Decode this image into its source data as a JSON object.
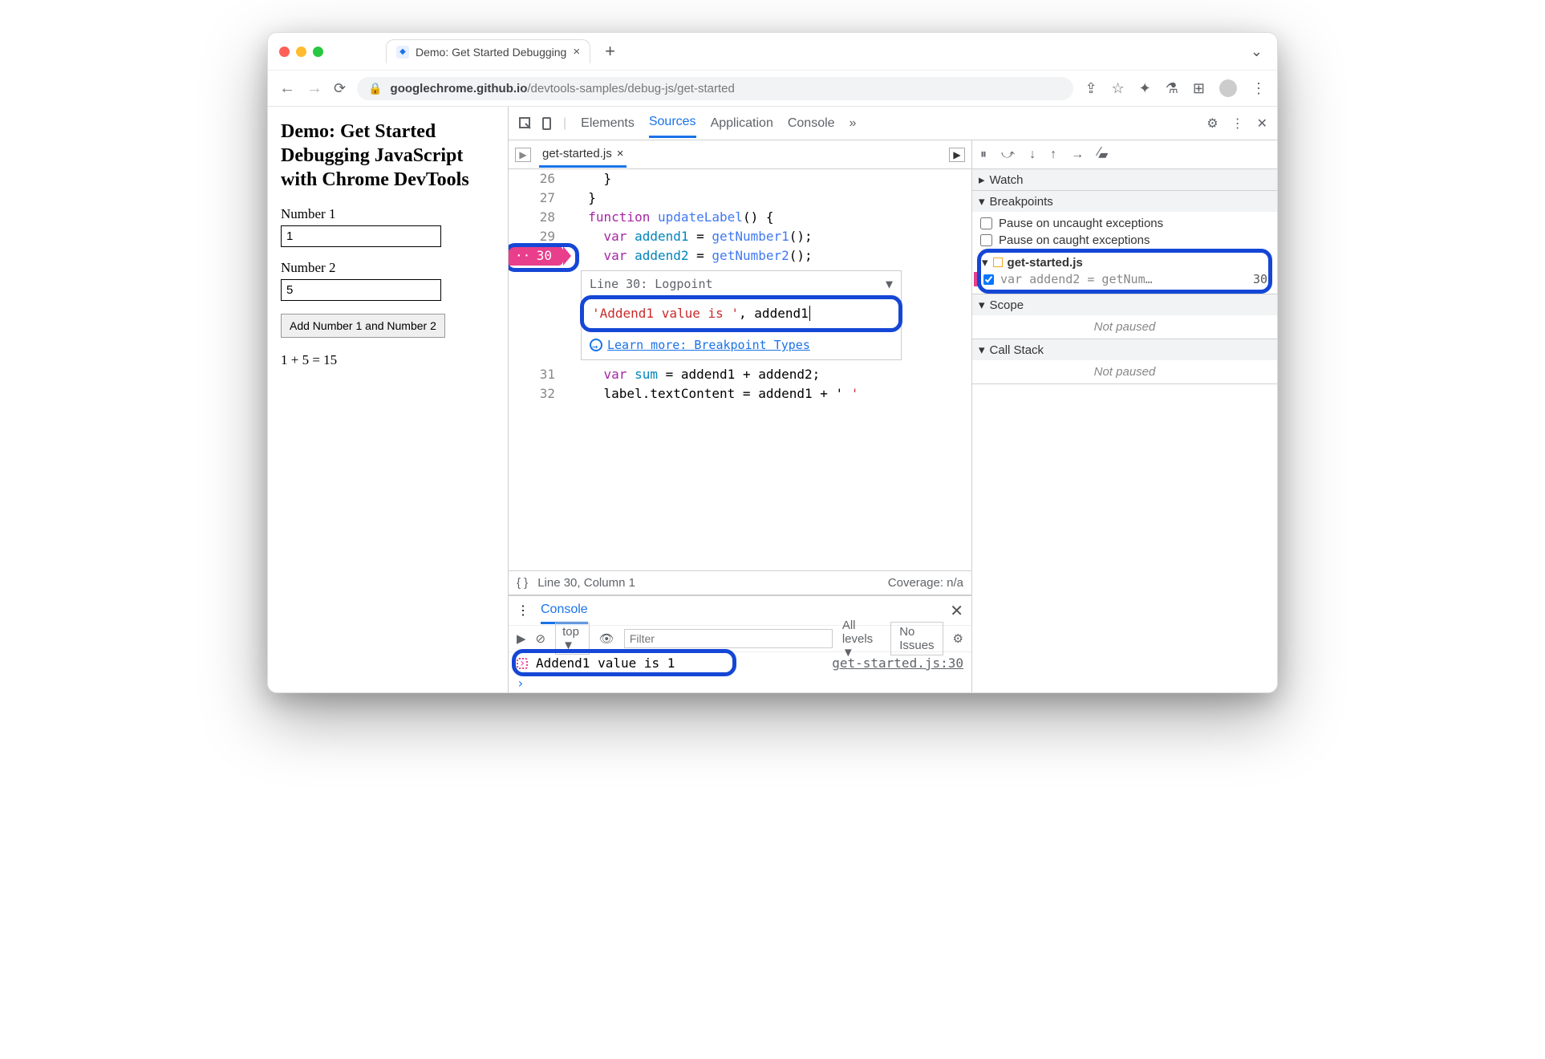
{
  "browser": {
    "tab_title": "Demo: Get Started Debugging",
    "url_host": "googlechrome.github.io",
    "url_path": "/devtools-samples/debug-js/get-started"
  },
  "page": {
    "heading": "Demo: Get Started Debugging JavaScript with Chrome DevTools",
    "label1": "Number 1",
    "value1": "1",
    "label2": "Number 2",
    "value2": "5",
    "button": "Add Number 1 and Number 2",
    "result": "1 + 5 = 15"
  },
  "devtools": {
    "tabs": [
      "Elements",
      "Sources",
      "Application",
      "Console"
    ],
    "active_tab": "Sources",
    "file": "get-started.js",
    "code": {
      "l26": "    }",
      "l27": "  }",
      "l28_a": "function",
      "l28_b": "updateLabel",
      "l28_c": "() {",
      "l29_a": "var",
      "l29_b": "addend1",
      "l29_c": " = ",
      "l29_d": "getNumber1",
      "l29_e": "();",
      "l30_a": "var",
      "l30_b": "addend2",
      "l30_c": " = ",
      "l30_d": "getNumber2",
      "l30_e": "();",
      "l31_a": "var",
      "l31_b": "sum",
      "l31_c": " = addend1 + addend2;",
      "l32": "    label.textContent = addend1 + ' "
    },
    "line_nums": {
      "n26": "26",
      "n27": "27",
      "n28": "28",
      "n29": "29",
      "n30": "30",
      "n31": "31",
      "n32": "32"
    },
    "logpoint": {
      "header": "Line 30:   Logpoint",
      "body": "'Addend1 value is ', addend1",
      "link": "Learn more: Breakpoint Types"
    },
    "status_left": "{ }",
    "status_pos": "Line 30, Column 1",
    "status_cov": "Coverage: n/a",
    "side": {
      "watch": "Watch",
      "breakpoints": "Breakpoints",
      "pause_uncaught": "Pause on uncaught exceptions",
      "pause_caught": "Pause on caught exceptions",
      "bp_file": "get-started.js",
      "bp_text": "var addend2 = getNum…",
      "bp_line": "30",
      "scope": "Scope",
      "not_paused": "Not paused",
      "callstack": "Call Stack",
      "not_paused2": "Not paused"
    }
  },
  "console": {
    "tab": "Console",
    "top": "top ▼",
    "filter_ph": "Filter",
    "levels": "All levels ▼",
    "issues": "No Issues",
    "msg": "Addend1 value is  1",
    "src": "get-started.js:30"
  }
}
